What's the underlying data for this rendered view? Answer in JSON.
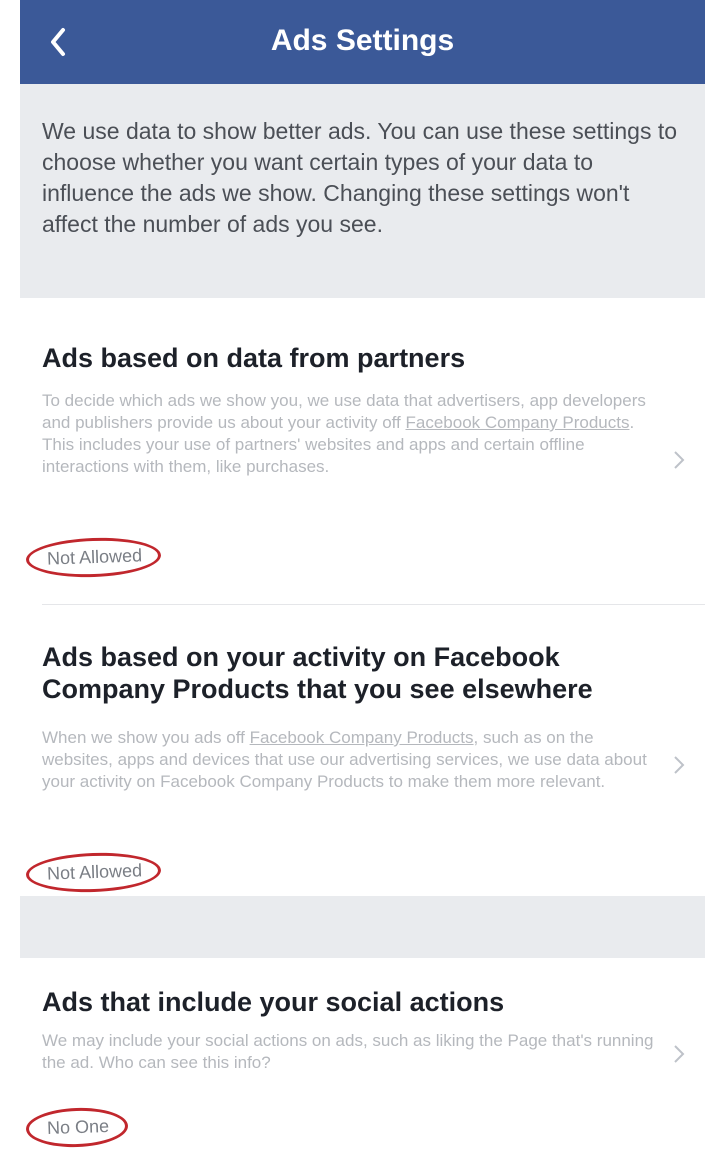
{
  "header": {
    "title": "Ads Settings",
    "back_icon": "chevron-left-icon",
    "color": "#3b5998"
  },
  "intro": {
    "text": "We use data to show better ads. You can use these settings to choose whether you want certain types of your data to influence the ads we show. Changing these settings won't affect the number of ads you see."
  },
  "settings": [
    {
      "title": "Ads based on data from partners",
      "desc_before": "To decide which ads we show you, we use data that advertisers, app developers and publishers provide us about your activity off ",
      "desc_link": "Facebook Company Products",
      "desc_after": ". This includes your use of partners' websites and apps and certain offline interactions with them, like purchases.",
      "value": "Not Allowed"
    },
    {
      "title": "Ads based on your activity on Facebook Company Products that you see elsewhere",
      "desc_before": "When we show you ads off ",
      "desc_link": "Facebook Company Products",
      "desc_after": ", such as on the websites, apps and devices that use our advertising services, we use data about your activity on Facebook Company Products to make them more relevant.",
      "value": "Not Allowed"
    },
    {
      "title": "Ads that include your social actions",
      "desc_before": "We may include your social actions on ads, such as liking the Page that's running the ad. Who can see this info?",
      "desc_link": "",
      "desc_after": "",
      "value": "No One"
    }
  ],
  "annotation_color": "#c1272d"
}
